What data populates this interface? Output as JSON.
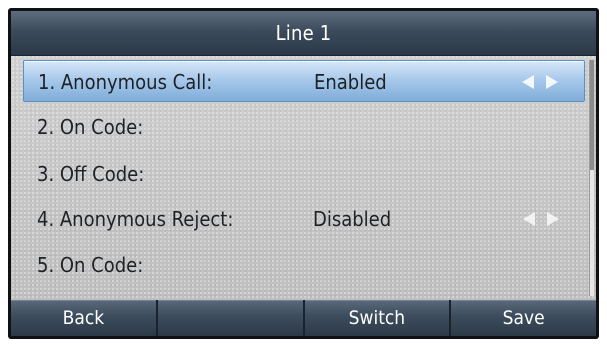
{
  "header": {
    "title": "Line 1"
  },
  "list": {
    "items": [
      {
        "label": "1. Anonymous Call:",
        "value": "Enabled",
        "selected": true,
        "has_arrows": true
      },
      {
        "label": "2. On Code:",
        "value": "",
        "selected": false,
        "has_arrows": false
      },
      {
        "label": "3. Off Code:",
        "value": "",
        "selected": false,
        "has_arrows": false
      },
      {
        "label": "4. Anonymous Reject:",
        "value": "Disabled",
        "selected": false,
        "has_arrows": true
      },
      {
        "label": "5. On Code:",
        "value": "",
        "selected": false,
        "has_arrows": false
      }
    ]
  },
  "softkeys": {
    "back": "Back",
    "empty": "",
    "switch": "Switch",
    "save": "Save"
  },
  "icons": {
    "left_arrow": "triangle-left-icon",
    "right_arrow": "triangle-right-icon"
  },
  "colors": {
    "title_bar": "#3c4b5b",
    "selection": "#a9c9eb",
    "softkey": "#3d4c5c"
  }
}
